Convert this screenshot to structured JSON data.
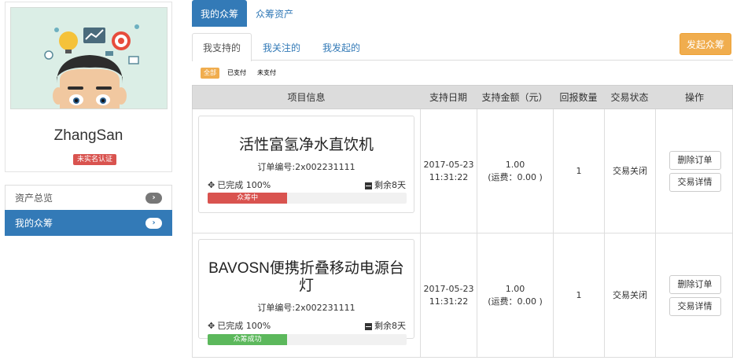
{
  "user": {
    "name": "ZhangSan",
    "verify_badge": "未实名认证"
  },
  "sidebar": {
    "items": [
      {
        "label": "资产总览",
        "active": false
      },
      {
        "label": "我的众筹",
        "active": true
      }
    ]
  },
  "tabs": [
    {
      "label": "我的众筹",
      "active": true
    },
    {
      "label": "众筹资产",
      "active": false
    }
  ],
  "subtabs": [
    {
      "label": "我支持的",
      "active": true
    },
    {
      "label": "我关注的",
      "active": false
    },
    {
      "label": "我发起的",
      "active": false
    }
  ],
  "launch_button": "发起众筹",
  "filters": [
    {
      "label": "全部",
      "active": true
    },
    {
      "label": "已支付",
      "active": false
    },
    {
      "label": "未支付",
      "active": false
    }
  ],
  "table": {
    "headers": [
      "项目信息",
      "支持日期",
      "支持金额（元）",
      "回报数量",
      "交易状态",
      "操作"
    ],
    "rows": [
      {
        "title": "活性富氢净水直饮机",
        "order_no": "订单编号:2x002231111",
        "done": "已完成 100%",
        "remaining": "剩余8天",
        "progress": 0.4,
        "progress_label": "众筹中",
        "progress_color": "#d9534f",
        "date": "2017-05-23",
        "time": "11:31:22",
        "amount": "1.00",
        "shipping": "(运费：0.00 )",
        "qty": "1",
        "status": "交易关闭",
        "ops": [
          "删除订单",
          "交易详情"
        ]
      },
      {
        "title": "BAVOSN便携折叠移动电源台灯",
        "order_no": "订单编号:2x002231111",
        "done": "已完成 100%",
        "remaining": "剩余8天",
        "progress": 0.4,
        "progress_label": "众筹成功",
        "progress_color": "#5cb85c",
        "date": "2017-05-23",
        "time": "11:31:22",
        "amount": "1.00",
        "shipping": "(运费：0.00 )",
        "qty": "1",
        "status": "交易关闭",
        "ops": [
          "删除订单",
          "交易详情"
        ]
      }
    ]
  },
  "colors": {
    "primary": "#337ab7",
    "warning": "#f0ad4e",
    "danger": "#d9534f",
    "success": "#5cb85c"
  }
}
